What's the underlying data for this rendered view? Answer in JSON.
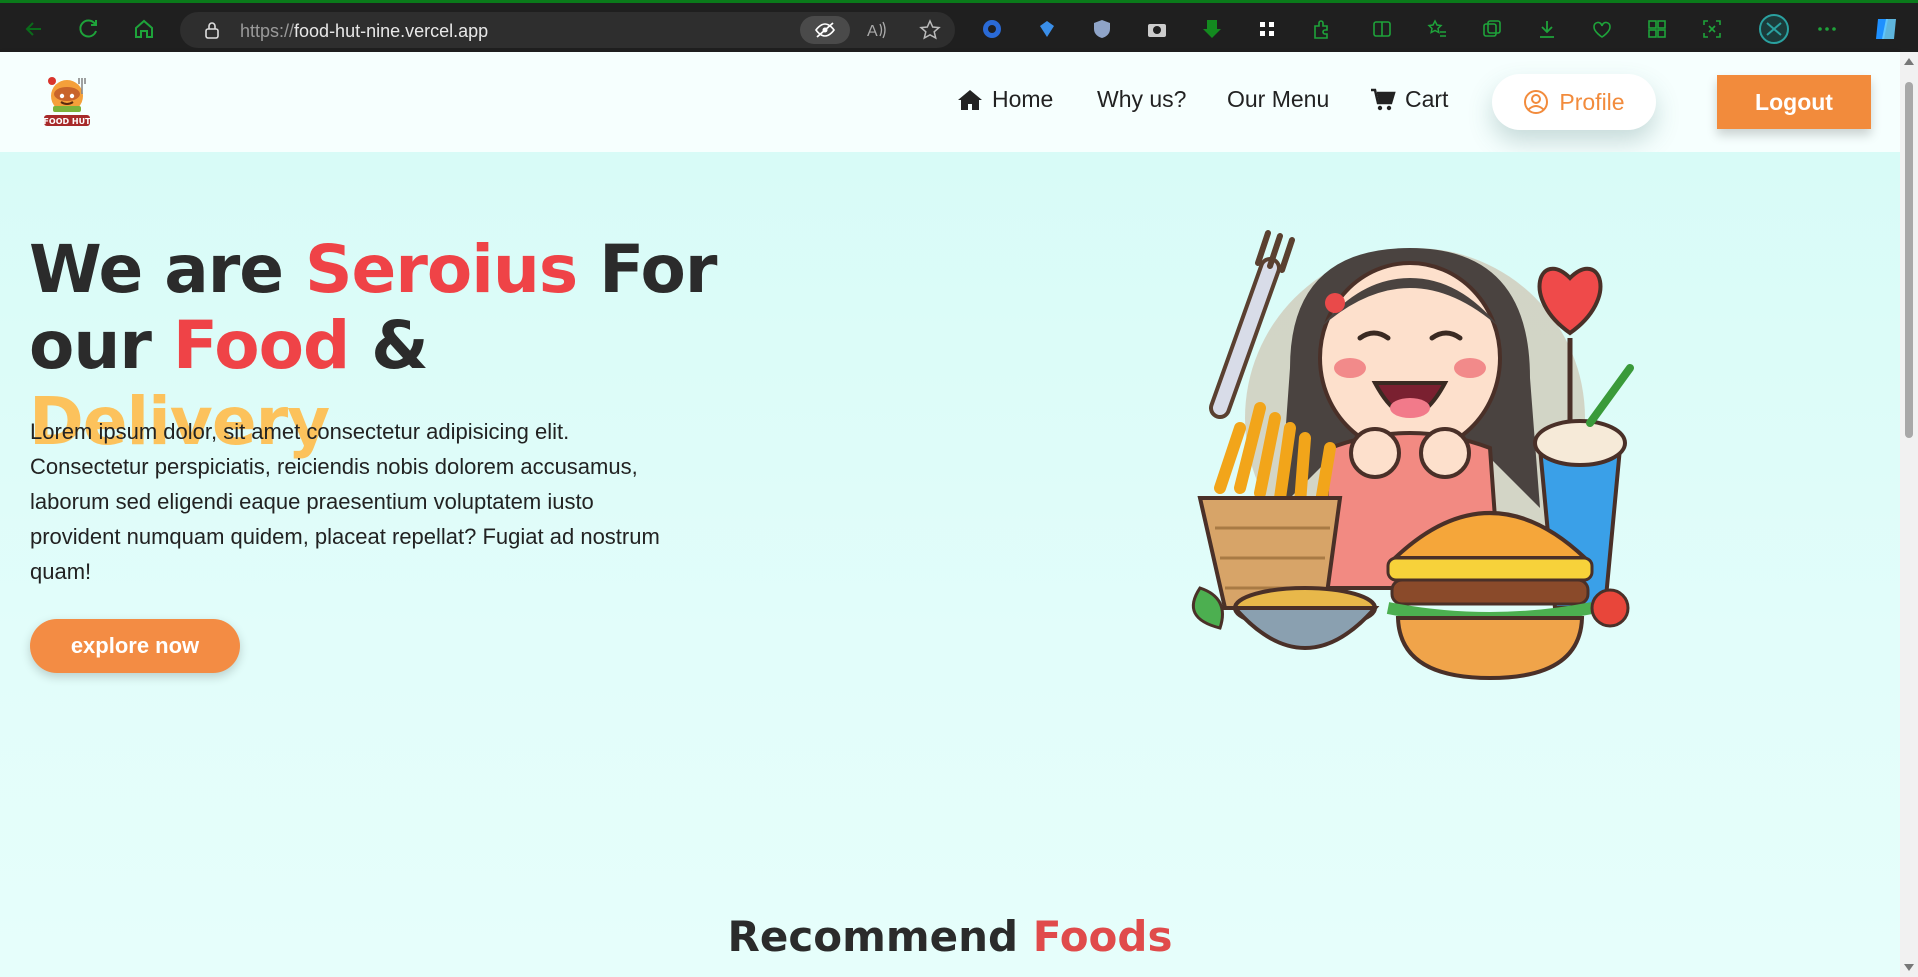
{
  "browser": {
    "url_protocol": "https://",
    "url_host": "food-hut-nine.vercel.app"
  },
  "header": {
    "logo_text": "FOOD HUT",
    "nav": [
      {
        "label": "Home",
        "icon": "home-icon"
      },
      {
        "label": "Why us?"
      },
      {
        "label": "Our Menu"
      },
      {
        "label": "Cart",
        "icon": "cart-icon"
      }
    ],
    "profile_label": "Profile",
    "logout_label": "Logout"
  },
  "hero": {
    "title_parts": {
      "p1": "We are ",
      "p2": "Seroius",
      "p3": " For",
      "p4": "our ",
      "p5": "Food",
      "p6": " & ",
      "p7": "Delivery"
    },
    "description": "Lorem ipsum dolor, sit amet consectetur adipisicing elit. Consectetur perspiciatis, reiciendis nobis dolorem accusamus, laborum sed eligendi eaque praesentium voluptatem iusto provident numquam quidem, placeat repellat? Fugiat ad nostrum quam!",
    "cta_label": "explore now"
  },
  "section": {
    "title_main": "Recommend ",
    "title_accent": "Foods"
  },
  "colors": {
    "accent_orange": "#f28b3c",
    "accent_red": "#ef4347",
    "accent_yellow": "#fcc25c",
    "page_bg": "#dffdfa"
  }
}
